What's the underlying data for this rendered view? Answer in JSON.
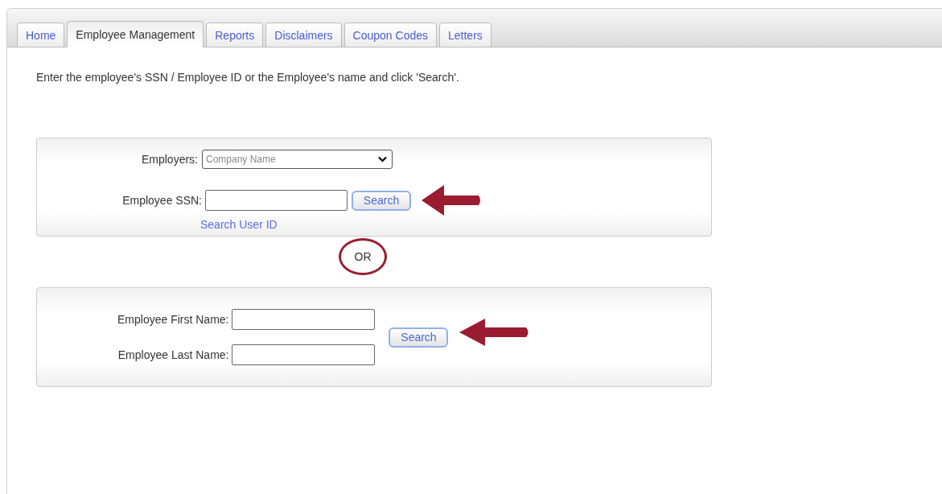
{
  "tabs": [
    {
      "label": "Home",
      "selected": false
    },
    {
      "label": "Employee Management",
      "selected": true
    },
    {
      "label": "Reports",
      "selected": false
    },
    {
      "label": "Disclaimers",
      "selected": false
    },
    {
      "label": "Coupon Codes",
      "selected": false
    },
    {
      "label": "Letters",
      "selected": false
    }
  ],
  "instructions": "Enter the employee's SSN / Employee ID or the Employee's name and click 'Search'.",
  "ssn_panel": {
    "employers_label": "Employers:",
    "employers_placeholder": "Company Name",
    "ssn_label": "Employee SSN:",
    "search_button": "Search",
    "link": "Search User ID"
  },
  "separator": "OR",
  "name_panel": {
    "first_name_label": "Employee First Name:",
    "last_name_label": "Employee Last Name:",
    "search_button": "Search"
  }
}
